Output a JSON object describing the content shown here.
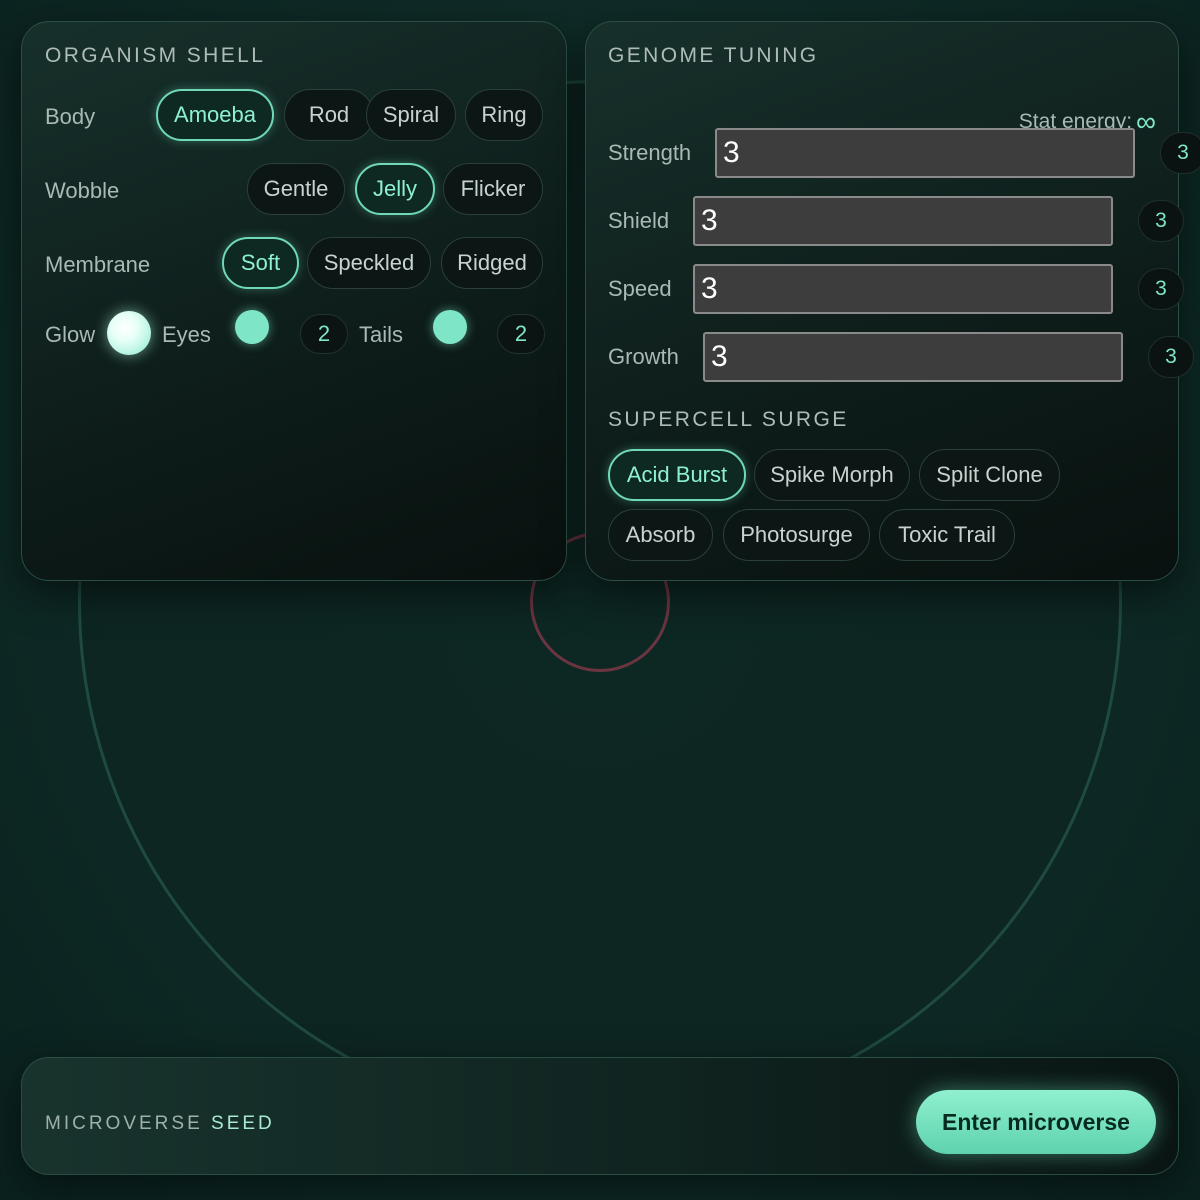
{
  "organism_shell": {
    "title": "ORGANISM SHELL",
    "body": {
      "label": "Body",
      "options": [
        "Amoeba",
        "Rod",
        "Spiral",
        "Ring"
      ],
      "selected": "Amoeba"
    },
    "wobble": {
      "label": "Wobble",
      "options": [
        "Gentle",
        "Jelly",
        "Flicker"
      ],
      "selected": "Jelly"
    },
    "membrane": {
      "label": "Membrane",
      "options": [
        "Soft",
        "Speckled",
        "Ridged"
      ],
      "selected": "Soft"
    },
    "glow_label": "Glow",
    "eyes": {
      "label": "Eyes",
      "value": "2"
    },
    "tails": {
      "label": "Tails",
      "value": "2"
    }
  },
  "genome_tuning": {
    "title": "GENOME TUNING",
    "energy_label": "Stat energy:",
    "energy_value": "∞",
    "stats": [
      {
        "label": "Strength",
        "value": "3",
        "badge": "3"
      },
      {
        "label": "Shield",
        "value": "3",
        "badge": "3"
      },
      {
        "label": "Speed",
        "value": "3",
        "badge": "3"
      },
      {
        "label": "Growth",
        "value": "3",
        "badge": "3"
      }
    ],
    "surge_title": "SUPERCELL SURGE",
    "surges": [
      "Acid Burst",
      "Spike Morph",
      "Split Clone",
      "Absorb",
      "Photosurge",
      "Toxic Trail"
    ],
    "surge_selected": "Acid Burst"
  },
  "seed": {
    "label_prefix": "MICROVERSE",
    "label_word": "SEED",
    "enter_label": "Enter microverse"
  },
  "colors": {
    "accent": "#7fe6c6",
    "background": "#0f2c28",
    "core_ring": "#6a3441"
  }
}
